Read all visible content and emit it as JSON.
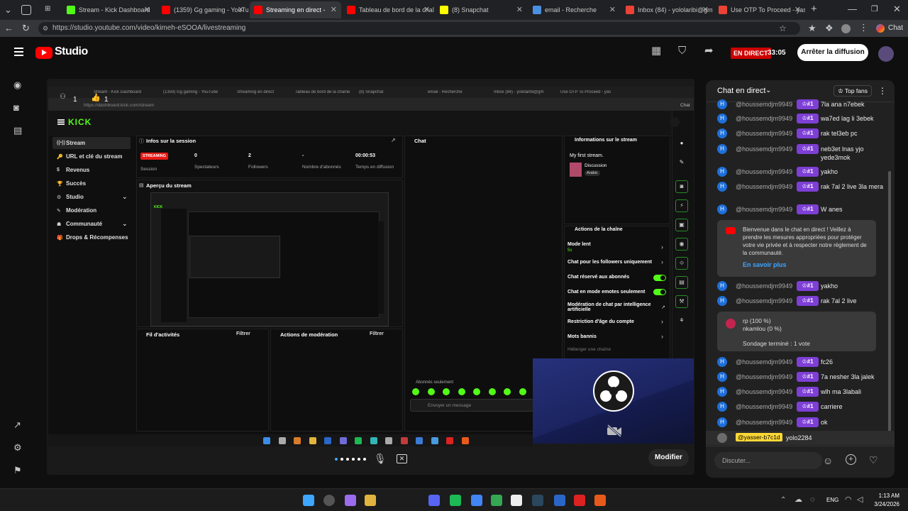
{
  "browser": {
    "tabs": [
      {
        "label": "Stream - Kick Dashboard",
        "fav_color": "#53fc18"
      },
      {
        "label": "(1359) Gg gaming - YouTube",
        "fav_color": "#ff0000"
      },
      {
        "label": "Streaming en direct -",
        "fav_color": "#ff0000"
      },
      {
        "label": "Tableau de bord de la chaîne",
        "fav_color": "#ff0000"
      },
      {
        "label": "(8) Snapchat",
        "fav_color": "#fffc00"
      },
      {
        "label": "email - Recherche",
        "fav_color": "#4a90e2"
      },
      {
        "label": "Inbox (84) - yololaribi@gmail.com",
        "fav_color": "#ea4335"
      },
      {
        "label": "Use OTP To Proceed - yassine",
        "fav_color": "#ea4335"
      }
    ],
    "url": "https://studio.youtube.com/video/kimeh-eSOOA/livestreaming",
    "chat_button": "Chat"
  },
  "studio": {
    "logo_text": "Studio",
    "live_badge": "EN DIRECT",
    "timer": "33:05",
    "stop_button": "Arrêter la diffusion",
    "edit_button": "Modifier"
  },
  "preview": {
    "viewers_count": "1",
    "likes_count": "1",
    "inner_tabs": [
      "Stream - Kick Dashboard",
      "(1359) Gg gaming - YouTube",
      "Streaming en direct",
      "Tableau de bord de la chaîne",
      "(8) Snapchat",
      "email - Recherche",
      "Inbox (84) - yololaribi@gm",
      "Use OTP To Proceed - yas"
    ],
    "inner_url": "https://dashboard.kick.com/stream",
    "inner_chat": "Chat",
    "kick_logo": "KICK",
    "kick_nav": [
      "Stream",
      "URL et clé du stream",
      "Revenus",
      "Succès",
      "Studio",
      "Modération",
      "Communauté",
      "Drops & Récompenses"
    ],
    "session": {
      "title": "Infos sur la session",
      "status": "STREAMING",
      "status_label": "Session",
      "stats": [
        {
          "value": "0",
          "label": "Spectateurs"
        },
        {
          "value": "2",
          "label": "Followers"
        },
        {
          "value": "-",
          "label": "Nombre d'abonnés"
        },
        {
          "value": "00:00:53",
          "label": "Temps en diffusion"
        }
      ]
    },
    "stream_preview_title": "Aperçu du stream",
    "activity_title": "Fil d'activités",
    "activity_filter": "Filtrer",
    "mod_actions_title": "Actions de modération",
    "mod_actions_filter": "Filtrer",
    "chat_title": "Chat",
    "chat_subs_only": "Abonnés seulement",
    "chat_placeholder": "Envoyer un message",
    "stream_info": {
      "title": "Informations sur le stream",
      "stream_name": "My first stream.",
      "category": "Discussion",
      "tag": "Arabic"
    },
    "channel_actions": {
      "title": "Actions de la chaîne",
      "slow_mode": "Mode lent",
      "slow_mode_value": "5s",
      "followers_only": "Chat pour les followers uniquement",
      "subs_only": "Chat réservé aux abonnés",
      "emotes_only": "Chat en mode emotes seulement",
      "ai_moderation": "Modération de chat par intelligence artificielle",
      "age_restriction": "Restriction d'âge du compte",
      "banned_words": "Mots bannis",
      "host": "Héberger une chaîne"
    }
  },
  "chat": {
    "title": "Chat en direct",
    "top_fans": "Top fans",
    "badge": "#1",
    "messages": [
      {
        "user": "@houssemdjm9949",
        "text": "7la ana n7ebek"
      },
      {
        "user": "@houssemdjm9949",
        "text": "wa7ed lag li 3ebek"
      },
      {
        "user": "@houssemdjm9949",
        "text": "rak tel3eb pc"
      },
      {
        "user": "@houssemdjm9949",
        "text": "neb3et lnas yjo yede3mok"
      },
      {
        "user": "@houssemdjm9949",
        "text": "yakho"
      },
      {
        "user": "@houssemdjm9949",
        "text": "rak 7al 2 live 3la mera"
      },
      {
        "user": "@houssemdjm9949",
        "text": "W anes"
      }
    ],
    "notice": {
      "text": "Bienvenue dans le chat en direct ! Veillez à prendre les mesures appropriées pour protéger votre vie privée et à respecter notre règlement de la communauté.",
      "link": "En savoir plus"
    },
    "messages2": [
      {
        "user": "@houssemdjm9949",
        "text": "yakho"
      },
      {
        "user": "@houssemdjm9949",
        "text": "rak 7al 2 live"
      }
    ],
    "poll": {
      "option1": "rp (100 %)",
      "option2": "nkamlou (0 %)",
      "status": "Sondage terminé : 1 vote"
    },
    "messages3": [
      {
        "user": "@houssemdjm9949",
        "text": "fc26"
      },
      {
        "user": "@houssemdjm9949",
        "text": "7a nesher 3la jalek"
      },
      {
        "user": "@houssemdjm9949",
        "text": "wlh ma 3labali"
      },
      {
        "user": "@houssemdjm9949",
        "text": "carriere"
      },
      {
        "user": "@houssemdjm9949",
        "text": "ok"
      }
    ],
    "highlight": {
      "user": "@yasser-b7c1d",
      "text": "yolo2284"
    },
    "input_placeholder": "Discuter..."
  },
  "taskbar": {
    "lang": "ENG",
    "time": "1:13 AM",
    "date": "3/24/2026"
  }
}
